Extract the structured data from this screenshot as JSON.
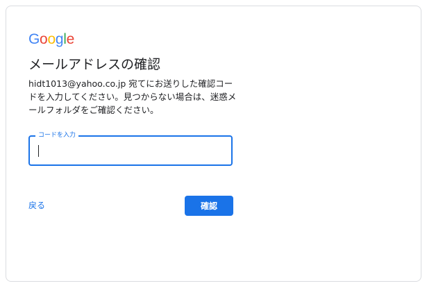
{
  "logo": {
    "letters": [
      "G",
      "o",
      "o",
      "g",
      "l",
      "e"
    ],
    "colors": [
      "#4285f4",
      "#ea4335",
      "#fbbc05",
      "#4285f4",
      "#34a853",
      "#ea4335"
    ]
  },
  "title": "メールアドレスの確認",
  "description": "hidt1013@yahoo.co.jp 宛てにお送りした確認コードを入力してください。見つからない場合は、迷惑メールフォルダをご確認ください。",
  "code_field": {
    "label": "コードを入力",
    "value": ""
  },
  "actions": {
    "back_label": "戻る",
    "confirm_label": "確認"
  },
  "colors": {
    "accent": "#1a73e8",
    "text": "#202124",
    "border": "#dadce0"
  }
}
